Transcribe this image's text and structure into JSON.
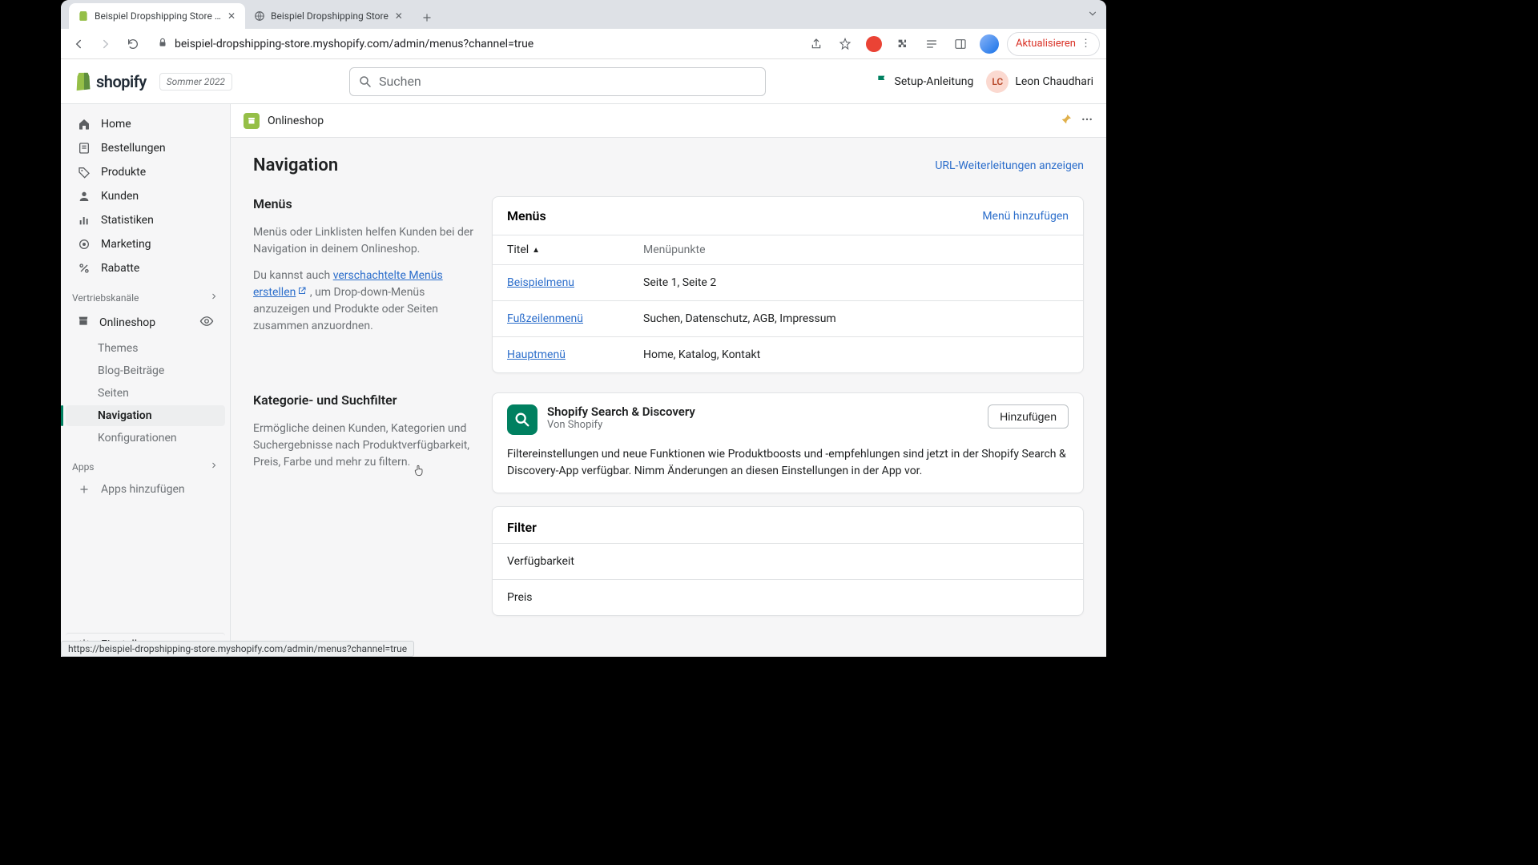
{
  "browser": {
    "tabs": [
      {
        "title": "Beispiel Dropshipping Store · N"
      },
      {
        "title": "Beispiel Dropshipping Store"
      }
    ],
    "url": "beispiel-dropshipping-store.myshopify.com/admin/menus?channel=true",
    "update_label": "Aktualisieren",
    "status_url": "https://beispiel-dropshipping-store.myshopify.com/admin/menus?channel=true"
  },
  "topbar": {
    "logo_text": "shopify",
    "season": "Sommer 2022",
    "search_placeholder": "Suchen",
    "setup_guide": "Setup-Anleitung",
    "user_initials": "LC",
    "user_name": "Leon Chaudhari"
  },
  "sidebar": {
    "home": "Home",
    "bestellungen": "Bestellungen",
    "produkte": "Produkte",
    "kunden": "Kunden",
    "statistiken": "Statistiken",
    "marketing": "Marketing",
    "rabatte": "Rabatte",
    "vertriebskanaele": "Vertriebskanäle",
    "onlineshop": "Onlineshop",
    "themes": "Themes",
    "blog": "Blog-Beiträge",
    "seiten": "Seiten",
    "navigation": "Navigation",
    "konfig": "Konfigurationen",
    "apps_section": "Apps",
    "apps_add": "Apps hinzufügen",
    "einstellungen": "Einstellungen"
  },
  "main_header": {
    "title": "Onlineshop"
  },
  "page": {
    "title": "Navigation",
    "url_redirects": "URL-Weiterleitungen anzeigen"
  },
  "menus_section": {
    "title": "Menüs",
    "desc1": "Menüs oder Linklisten helfen Kunden bei der Navigation in deinem Onlineshop.",
    "desc2_pre": "Du kannst auch ",
    "desc2_link": "verschachtelte Menüs erstellen",
    "desc2_post": " , um Drop-down-Menüs anzuzeigen und Produkte oder Seiten zusammen anzuordnen."
  },
  "menus_card": {
    "title": "Menüs",
    "add_link": "Menü hinzufügen",
    "col_title": "Titel",
    "col_items": "Menüpunkte",
    "rows": [
      {
        "name": "Beispielmenu",
        "items": "Seite 1, Seite 2"
      },
      {
        "name": "Fußzeilenmenü",
        "items": "Suchen, Datenschutz, AGB, Impressum"
      },
      {
        "name": "Hauptmenü",
        "items": "Home, Katalog, Kontakt"
      }
    ]
  },
  "category_section": {
    "title": "Kategorie- und Suchfilter",
    "desc": "Ermögliche deinen Kunden, Kategorien und Suchergebnisse nach Produktverfügbarkeit, Preis, Farbe und mehr zu filtern."
  },
  "discovery": {
    "app_name": "Shopify Search & Discovery",
    "vendor": "Von Shopify",
    "add_btn": "Hinzufügen",
    "body": "Filtereinstellungen und neue Funktionen wie Produktboosts und -empfehlungen sind jetzt in der Shopify Search & Discovery-App verfügbar. Nimm Änderungen an diesen Einstellungen in der App vor."
  },
  "filter_card": {
    "title": "Filter",
    "items": [
      "Verfügbarkeit",
      "Preis"
    ]
  }
}
